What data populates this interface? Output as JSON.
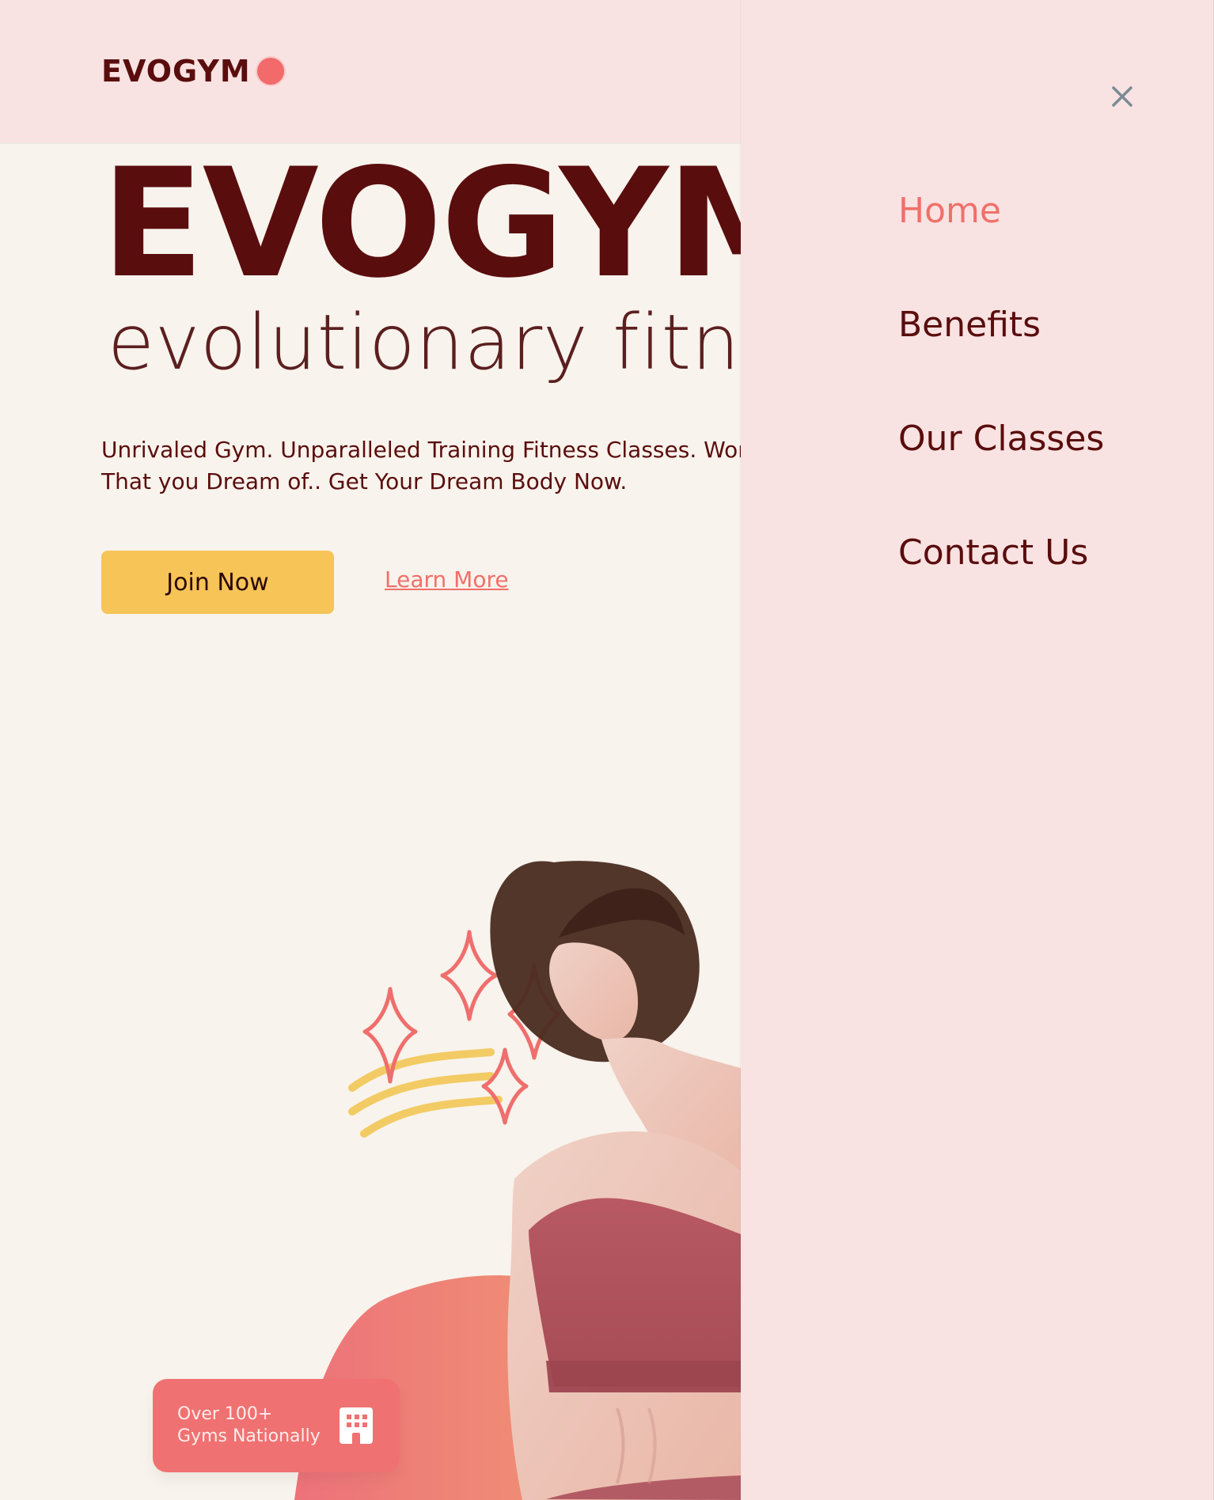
{
  "header": {
    "logo_text": "EVOGYM"
  },
  "hero": {
    "title": "EVOGYM",
    "subtitle": "evolutionary fitness",
    "description_lines": [
      "Unrivaled Gym. Unparalleled Training Fitness Classes. World Class Studios to get the Body Shapes",
      "That you Dream of.. Get Your Dream Body Now."
    ],
    "join_label": "Join Now",
    "learn_label": "Learn More"
  },
  "badge": {
    "line1": "Over 100+",
    "line2": "Gyms Nationally"
  },
  "side_menu": {
    "items": [
      {
        "label": "Home",
        "active": true
      },
      {
        "label": "Benefits",
        "active": false
      },
      {
        "label": "Our Classes",
        "active": false
      },
      {
        "label": "Contact Us",
        "active": false
      }
    ]
  },
  "colors": {
    "background": "#f8f3ec",
    "panel_pink": "#f9e2e2",
    "brand_maroon": "#5a0d0d",
    "accent_coral": "#f0706a",
    "cta_yellow": "#f6c457"
  },
  "icons": {
    "logo_dot": "logo-dot-icon",
    "close": "close-icon",
    "building": "building-icon",
    "sparkles": "sparkle-icon",
    "waves": "wave-lines-icon"
  }
}
